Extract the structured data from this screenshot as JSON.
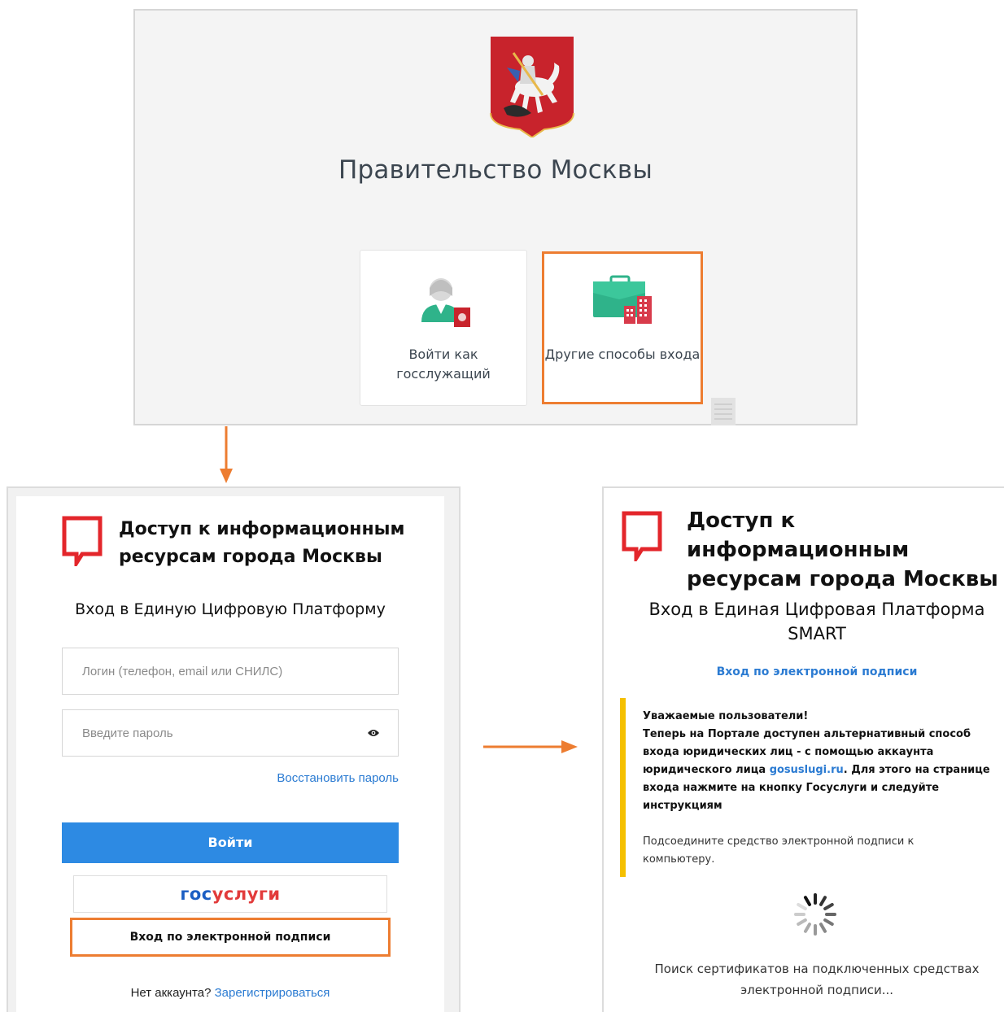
{
  "gov_panel": {
    "title": "Правительство Москвы",
    "coat_of_arms_icon": "moscow-coat-of-arms",
    "cards": [
      {
        "label": "Войти как госслужащий",
        "icon": "civil-servant-icon"
      },
      {
        "label": "Другие способы входа",
        "icon": "briefcase-building-icon"
      }
    ]
  },
  "login_panel": {
    "header_title": "Доступ к информационным ресурсам города Москвы",
    "subtitle": "Вход в Единую Цифровую Платформу",
    "login_placeholder": "Логин (телефон, email или СНИЛС)",
    "password_placeholder": "Введите пароль",
    "restore_password": "Восстановить пароль",
    "login_button": "Войти",
    "gosuslugi_part1": "гос",
    "gosuslugi_part2": "услуги",
    "esig_button": "Вход по электронной подписи",
    "no_account": "Нет аккаунта?",
    "register_link": "Зарегистрироваться"
  },
  "esig_panel": {
    "header_title": "Доступ к информационным ресурсам города Москвы",
    "subtitle": "Вход в Единая Цифровая Платформа SMART",
    "esig_link": "Вход по электронной подписи",
    "notice_heading": "Уважаемые пользователи!",
    "notice_body_1": "Теперь на Портале доступен альтернативный способ входа юридических лиц - с помощью аккаунта юридического лица",
    "notice_link": "gosuslugi.ru",
    "notice_body_2": ". Для этого на странице входа нажмите на кнопку Госуслуги и следуйте инструкциям",
    "connect_text": "Подсоедините средство электронной подписи к компьютеру.",
    "search_text": "Поиск сертификатов на подключенных средствах электронной подписи..."
  },
  "colors": {
    "highlight": "#ed7d31",
    "primary_blue": "#2d8ae3",
    "link_blue": "#2b7bd2",
    "mos_red": "#e3262b",
    "notice_yellow": "#f5c000"
  }
}
